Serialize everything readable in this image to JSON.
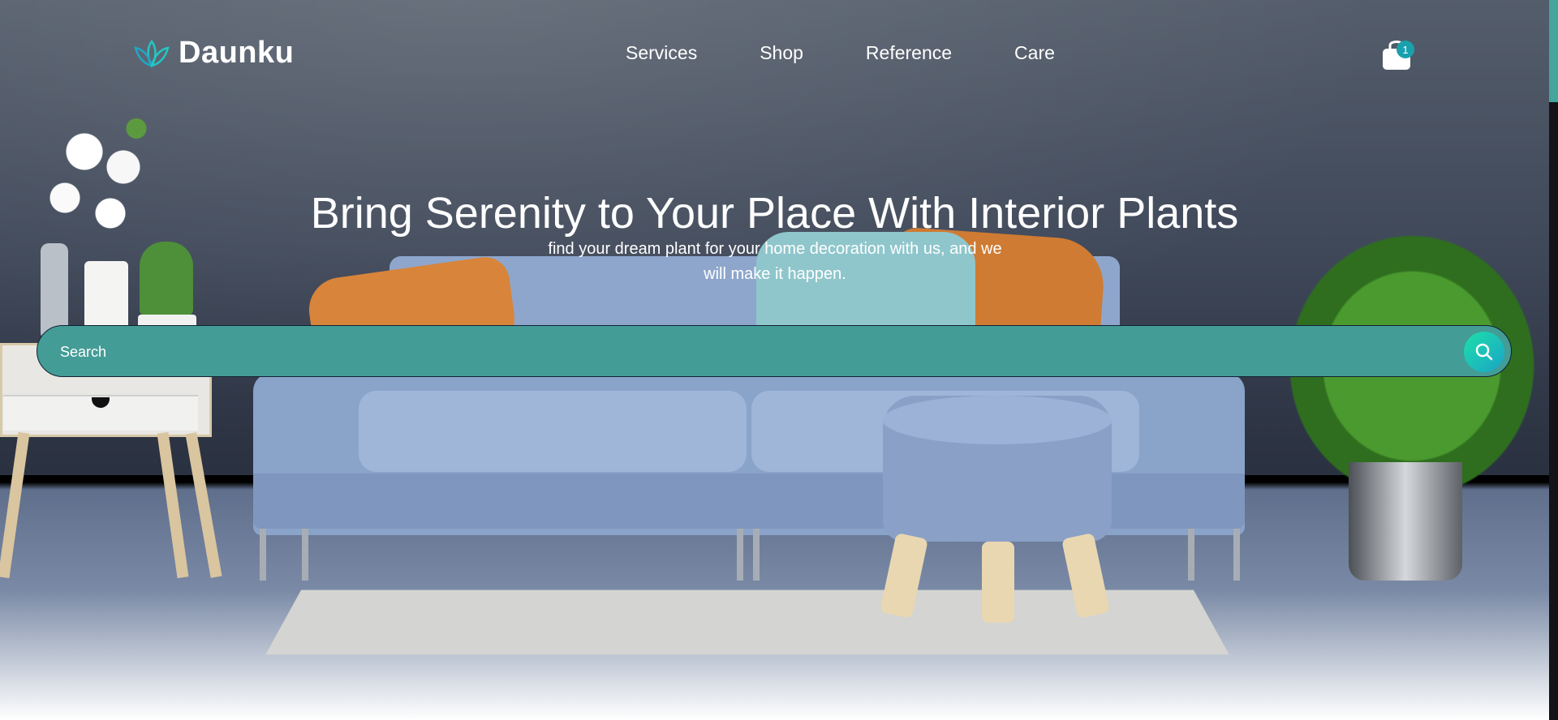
{
  "header": {
    "brand": "Daunku",
    "nav": [
      "Services",
      "Shop",
      "Reference",
      "Care"
    ],
    "cart_count": "1"
  },
  "hero": {
    "title": "Bring Serenity to Your Place With Interior Plants",
    "subtitle": "find your dream plant for your home decoration with us, and we will make it happen."
  },
  "search": {
    "placeholder": "Search"
  },
  "icons": {
    "logo": "lotus-icon",
    "cart": "shopping-bag-icon",
    "search": "search-icon"
  },
  "colors": {
    "accent": "#449c96",
    "badge": "#1aa0ad",
    "search_button_gradient": [
      "#1ee0a8",
      "#1aa3c8"
    ]
  }
}
